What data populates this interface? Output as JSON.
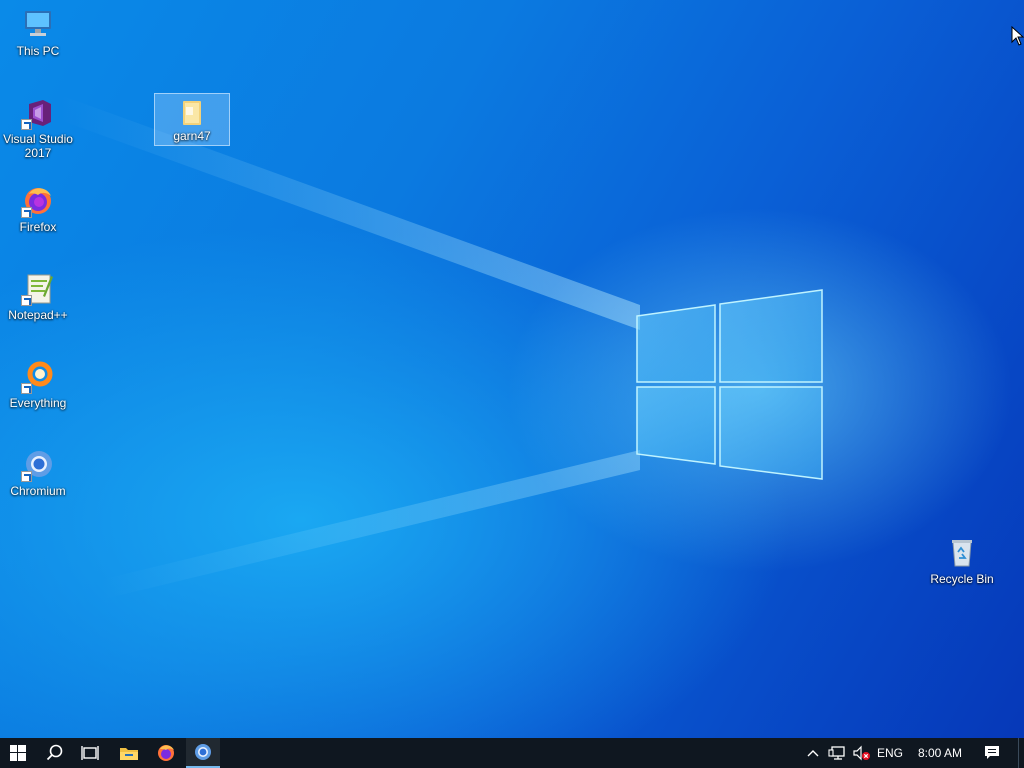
{
  "desktop": {
    "icons": [
      {
        "label": "This PC",
        "icon": "computer-icon"
      },
      {
        "label": "Visual Studio 2017",
        "label_line1": "Visual Studio",
        "label_line2": "2017",
        "icon": "visual-studio-icon"
      },
      {
        "label": "Firefox",
        "icon": "firefox-icon"
      },
      {
        "label": "Notepad++",
        "icon": "notepad-plus-plus-icon"
      },
      {
        "label": "Everything",
        "icon": "everything-search-icon"
      },
      {
        "label": "Chromium",
        "icon": "chromium-icon"
      },
      {
        "label": "garn47",
        "icon": "folder-icon"
      },
      {
        "label": "Recycle Bin",
        "icon": "recycle-bin-icon"
      }
    ]
  },
  "taskbar": {
    "pinned": [
      {
        "name": "start",
        "icon": "windows-start-icon"
      },
      {
        "name": "search",
        "icon": "search-icon"
      },
      {
        "name": "task-view",
        "icon": "task-view-icon"
      },
      {
        "name": "file-explorer",
        "icon": "file-explorer-icon"
      },
      {
        "name": "firefox",
        "icon": "firefox-icon"
      },
      {
        "name": "chromium",
        "icon": "chromium-icon",
        "active": true
      }
    ],
    "tray": {
      "language": "ENG",
      "time": "8:00 AM"
    }
  },
  "colors": {
    "taskbar_bg": "#0f1720",
    "accent": "#76b9ed",
    "wallpaper_blue": "#0a7ae0"
  }
}
